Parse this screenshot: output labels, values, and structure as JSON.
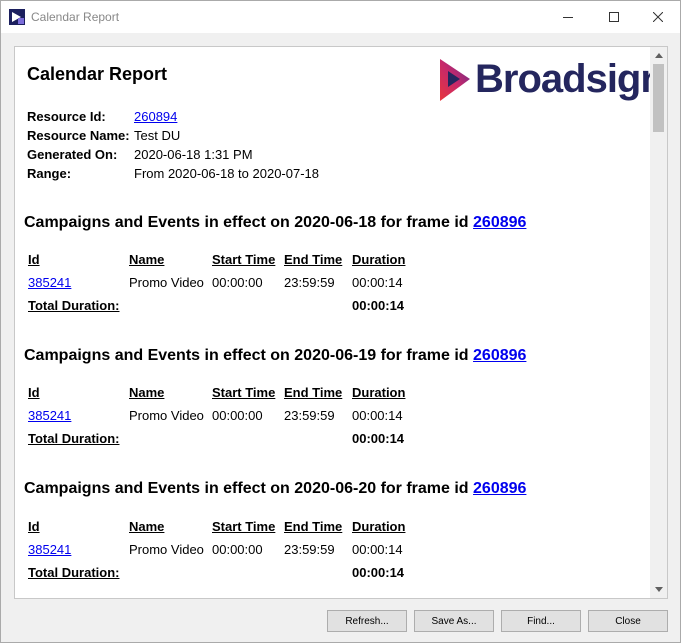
{
  "window": {
    "title": "Calendar Report"
  },
  "report": {
    "title": "Calendar Report",
    "logo_text": "Broadsign",
    "info": [
      {
        "label": "Resource Id:",
        "value": "260894",
        "is_link": true
      },
      {
        "label": "Resource Name:",
        "value": "Test DU",
        "is_link": false
      },
      {
        "label": "Generated On:",
        "value": "2020-06-18 1:31 PM",
        "is_link": false
      },
      {
        "label": "Range:",
        "value": "From 2020-06-18 to 2020-07-18",
        "is_link": false
      }
    ],
    "columns": {
      "id": "Id",
      "name": "Name",
      "start": "Start Time",
      "end": "End Time",
      "duration": "Duration"
    },
    "total_label": "Total Duration:",
    "sections": [
      {
        "heading_prefix": "Campaigns and Events in effect on 2020-06-18 for frame id",
        "frame_id": "260896",
        "row": {
          "id": "385241",
          "name": "Promo Video",
          "start": "00:00:00",
          "end": "23:59:59",
          "duration": "00:00:14"
        },
        "total": "00:00:14"
      },
      {
        "heading_prefix": "Campaigns and Events in effect on 2020-06-19 for frame id",
        "frame_id": "260896",
        "row": {
          "id": "385241",
          "name": "Promo Video",
          "start": "00:00:00",
          "end": "23:59:59",
          "duration": "00:00:14"
        },
        "total": "00:00:14"
      },
      {
        "heading_prefix": "Campaigns and Events in effect on 2020-06-20 for frame id",
        "frame_id": "260896",
        "row": {
          "id": "385241",
          "name": "Promo Video",
          "start": "00:00:00",
          "end": "23:59:59",
          "duration": "00:00:14"
        },
        "total": "00:00:14"
      }
    ]
  },
  "buttons": {
    "refresh": "Refresh...",
    "save_as": "Save As...",
    "find": "Find...",
    "close": "Close"
  },
  "colors": {
    "link": "#0000ee",
    "brand_navy": "#24265e",
    "brand_gradient_start": "#e8363d",
    "brand_gradient_end": "#5b2d8e"
  }
}
